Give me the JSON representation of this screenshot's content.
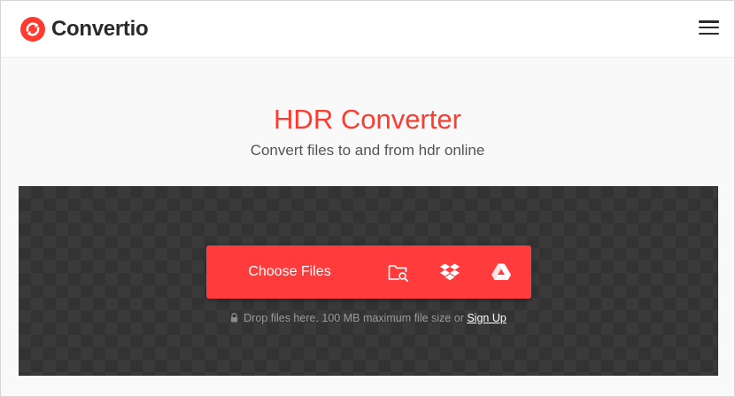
{
  "header": {
    "brand_name": "Convertio",
    "logo_icon": "convertio-logo-icon",
    "menu_icon": "hamburger-menu-icon"
  },
  "hero": {
    "title": "HDR Converter",
    "subtitle": "Convert files to and from hdr online"
  },
  "upload": {
    "choose_files_label": "Choose Files",
    "sources": [
      {
        "name": "from-computer",
        "icon": "folder-search-icon"
      },
      {
        "name": "from-dropbox",
        "icon": "dropbox-icon"
      },
      {
        "name": "from-google-drive",
        "icon": "google-drive-icon"
      }
    ],
    "hint_text": "Drop files here. 100 MB maximum file size or",
    "signup_link": "Sign Up"
  },
  "colors": {
    "accent": "#ff3b3b",
    "title": "#ff3b30",
    "brand_text": "#2a2a2a",
    "upload_bg": "#3a3a3a"
  }
}
